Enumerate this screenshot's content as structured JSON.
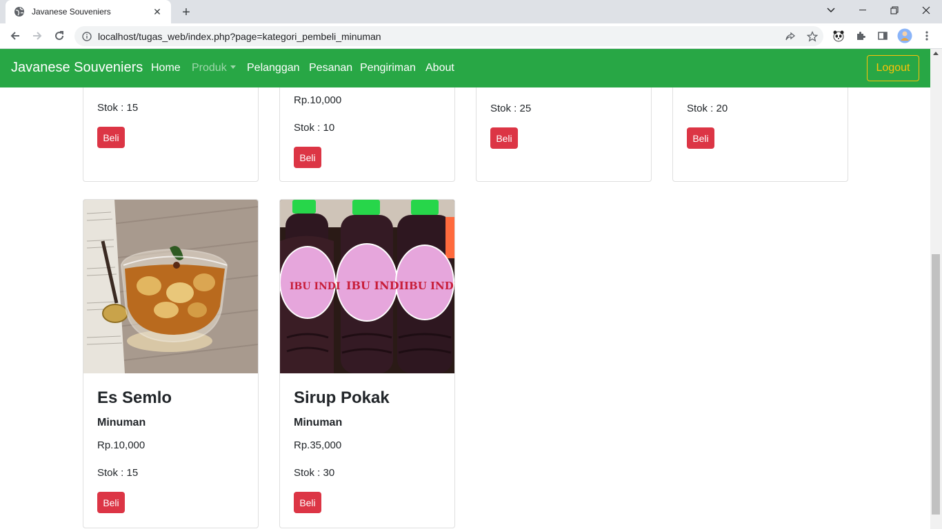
{
  "browser": {
    "tab_title": "Javanese Souveniers",
    "url": "localhost/tugas_web/index.php?page=kategori_pembeli_minuman"
  },
  "navbar": {
    "brand": "Javanese Souveniers",
    "links": [
      "Home",
      "Produk",
      "Pelanggan",
      "Pesanan",
      "Pengiriman",
      "About"
    ],
    "logout": "Logout"
  },
  "top_cards": [
    {
      "stok": "Stok : 15",
      "button": "Beli"
    },
    {
      "price": "Rp.10,000",
      "stok": "Stok : 10",
      "button": "Beli"
    },
    {
      "stok": "Stok : 25",
      "button": "Beli"
    },
    {
      "stok": "Stok : 20",
      "button": "Beli"
    }
  ],
  "products": [
    {
      "name": "Es Semlo",
      "category": "Minuman",
      "price": "Rp.10,000",
      "stok": "Stok : 15",
      "button": "Beli"
    },
    {
      "name": "Sirup Pokak",
      "category": "Minuman",
      "price": "Rp.35,000",
      "stok": "Stok : 30",
      "button": "Beli",
      "label_text": "IBU INDI"
    }
  ],
  "colors": {
    "navbar": "#28a745",
    "button": "#dc3545",
    "logout": "#ffc107"
  }
}
